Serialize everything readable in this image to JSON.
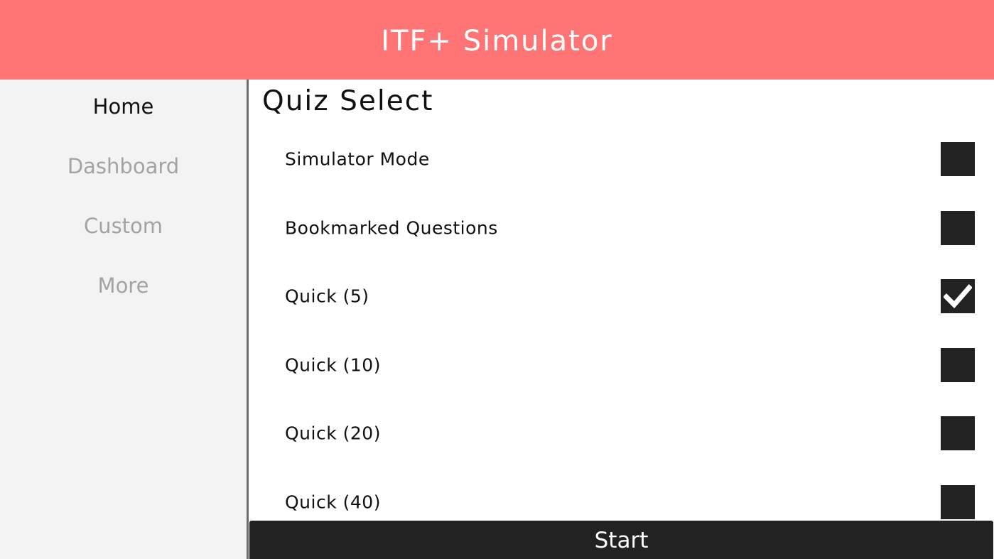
{
  "app": {
    "title": "ITF+ Simulator",
    "accent_color": "#ff7575"
  },
  "sidebar": {
    "items": [
      {
        "label": "Home",
        "active": true
      },
      {
        "label": "Dashboard",
        "active": false
      },
      {
        "label": "Custom",
        "active": false
      },
      {
        "label": "More",
        "active": false
      }
    ]
  },
  "main": {
    "title": "Quiz Select",
    "options": [
      {
        "label": "Simulator Mode",
        "checked": false
      },
      {
        "label": "Bookmarked Questions",
        "checked": false
      },
      {
        "label": "Quick (5)",
        "checked": true
      },
      {
        "label": "Quick (10)",
        "checked": false
      },
      {
        "label": "Quick (20)",
        "checked": false
      },
      {
        "label": "Quick (40)",
        "checked": false
      }
    ],
    "start_label": "Start"
  }
}
